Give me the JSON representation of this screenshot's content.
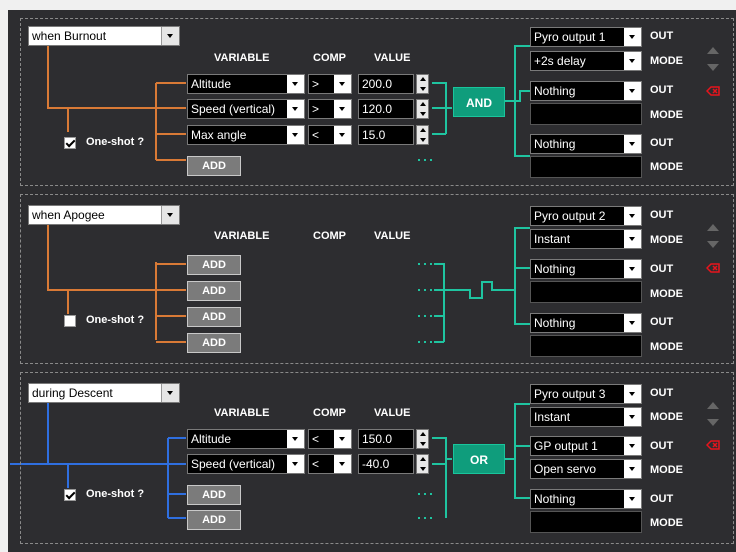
{
  "columns": {
    "variable": "VARIABLE",
    "comp": "COMP",
    "value": "VALUE"
  },
  "out_label": "OUT",
  "mode_label": "MODE",
  "add_label": "ADD",
  "oneshot_label": "One-shot ?",
  "rules": [
    {
      "trigger": "when Burnout",
      "oneshot_checked": true,
      "conditions": [
        {
          "variable": "Altitude",
          "comp": ">",
          "value": "200.0"
        },
        {
          "variable": "Speed (vertical)",
          "comp": ">",
          "value": "120.0"
        },
        {
          "variable": "Max angle",
          "comp": "<",
          "value": "15.0"
        }
      ],
      "logic": "AND",
      "outputs": [
        {
          "out": "Pyro output 1",
          "mode": "+2s delay"
        },
        {
          "out": "Nothing",
          "mode": ""
        },
        {
          "out": "Nothing",
          "mode": ""
        }
      ]
    },
    {
      "trigger": "when Apogee",
      "oneshot_checked": false,
      "conditions": [],
      "logic": "",
      "outputs": [
        {
          "out": "Pyro output 2",
          "mode": "Instant"
        },
        {
          "out": "Nothing",
          "mode": ""
        },
        {
          "out": "Nothing",
          "mode": ""
        }
      ]
    },
    {
      "trigger": "during Descent",
      "oneshot_checked": true,
      "conditions": [
        {
          "variable": "Altitude",
          "comp": "<",
          "value": "150.0"
        },
        {
          "variable": "Speed (vertical)",
          "comp": "<",
          "value": "-40.0"
        }
      ],
      "logic": "OR",
      "outputs": [
        {
          "out": "Pyro output 3",
          "mode": "Instant"
        },
        {
          "out": "GP output 1",
          "mode": "Open servo"
        },
        {
          "out": "Nothing",
          "mode": ""
        }
      ]
    }
  ],
  "colors": {
    "orange": "#d97a36",
    "teal": "#1fc4a0",
    "blue": "#2f6fe0",
    "panel": "#2d2d30",
    "delete": "#e8141c"
  },
  "icons": [
    "chevron-down-icon",
    "move-up-icon",
    "move-down-icon",
    "delete-rule-icon",
    "checkbox-icon"
  ]
}
